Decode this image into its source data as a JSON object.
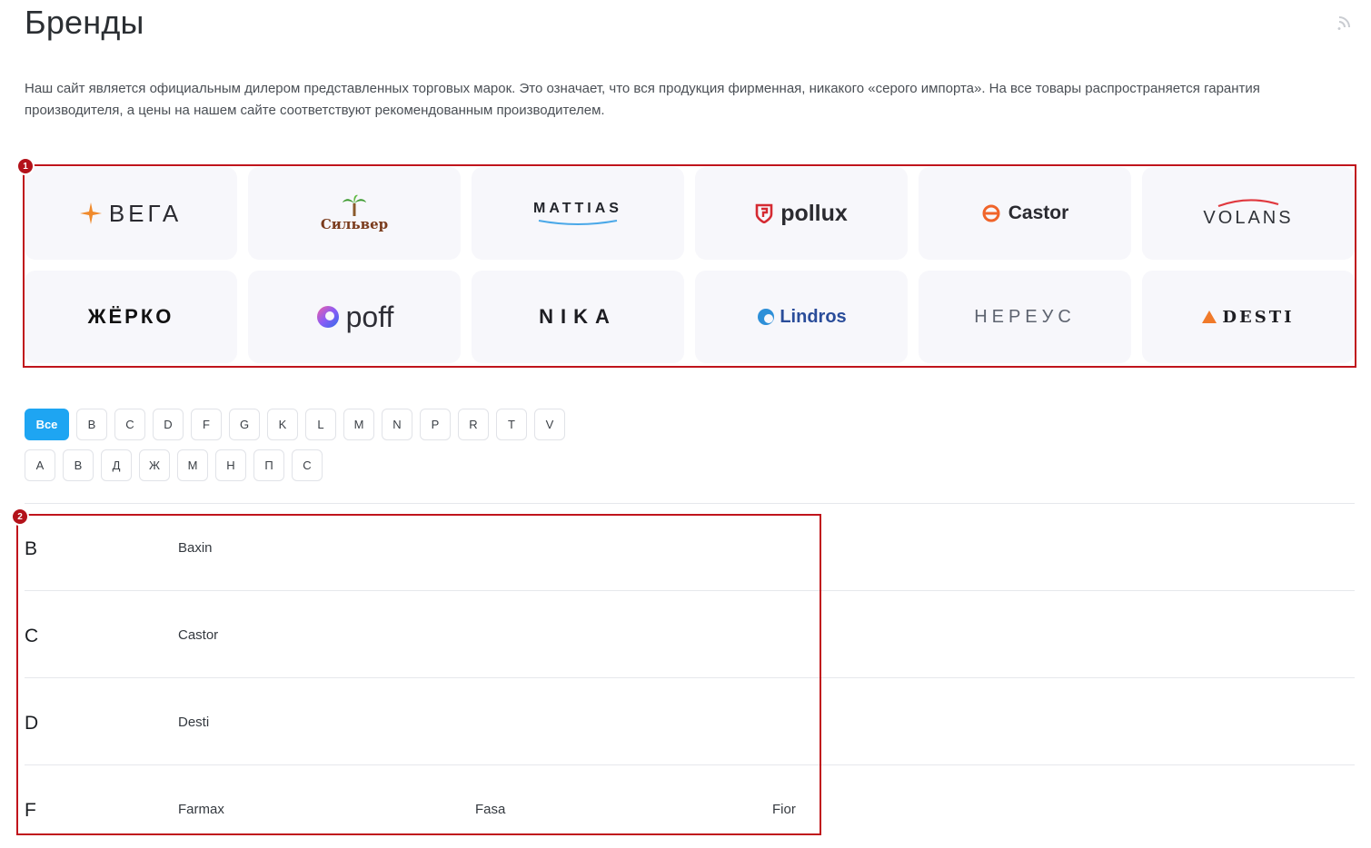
{
  "page": {
    "title": "Бренды"
  },
  "intro": "Наш сайт является официальным дилером представленных торговых марок. Это означает, что вся продукция фирменная, никакого «серого импорта». На все товары распространяется гарантия производителя, а цены на нашем сайте соответствуют рекомендованным производителем.",
  "brands": [
    {
      "label": "ВЕГА",
      "icon": "star-icon"
    },
    {
      "label": "Сильвер",
      "icon": "palm-tree-icon"
    },
    {
      "label": "MATTIAS",
      "icon": "wave-icon"
    },
    {
      "label": "pollux",
      "icon": "shield-icon"
    },
    {
      "label": "Castor",
      "icon": "castor-icon"
    },
    {
      "label": "VOLANS",
      "icon": "swoosh-icon"
    },
    {
      "label": "ЖЁРКО",
      "icon": ""
    },
    {
      "label": "poff",
      "icon": "swirl-icon"
    },
    {
      "label": "NIKA",
      "icon": ""
    },
    {
      "label": "Lindros",
      "icon": "lindros-icon"
    },
    {
      "label": "НЕРЕУС",
      "icon": ""
    },
    {
      "label": "DESTI",
      "icon": "triangle-icon"
    }
  ],
  "filters": {
    "latin": [
      "Все",
      "B",
      "C",
      "D",
      "F",
      "G",
      "K",
      "L",
      "M",
      "N",
      "P",
      "R",
      "T",
      "V"
    ],
    "cyrillic": [
      "А",
      "В",
      "Д",
      "Ж",
      "М",
      "Н",
      "П",
      "С"
    ]
  },
  "annotations": [
    "1",
    "2"
  ],
  "list": [
    {
      "letter": "B",
      "brands": [
        "Baxin"
      ]
    },
    {
      "letter": "C",
      "brands": [
        "Castor"
      ]
    },
    {
      "letter": "D",
      "brands": [
        "Desti"
      ]
    },
    {
      "letter": "F",
      "brands": [
        "Farmax",
        "Fasa",
        "Fior"
      ]
    }
  ],
  "colors": {
    "accent": "#1ea5f2",
    "annotation": "#c0141c",
    "card": "#f7f7fb"
  }
}
